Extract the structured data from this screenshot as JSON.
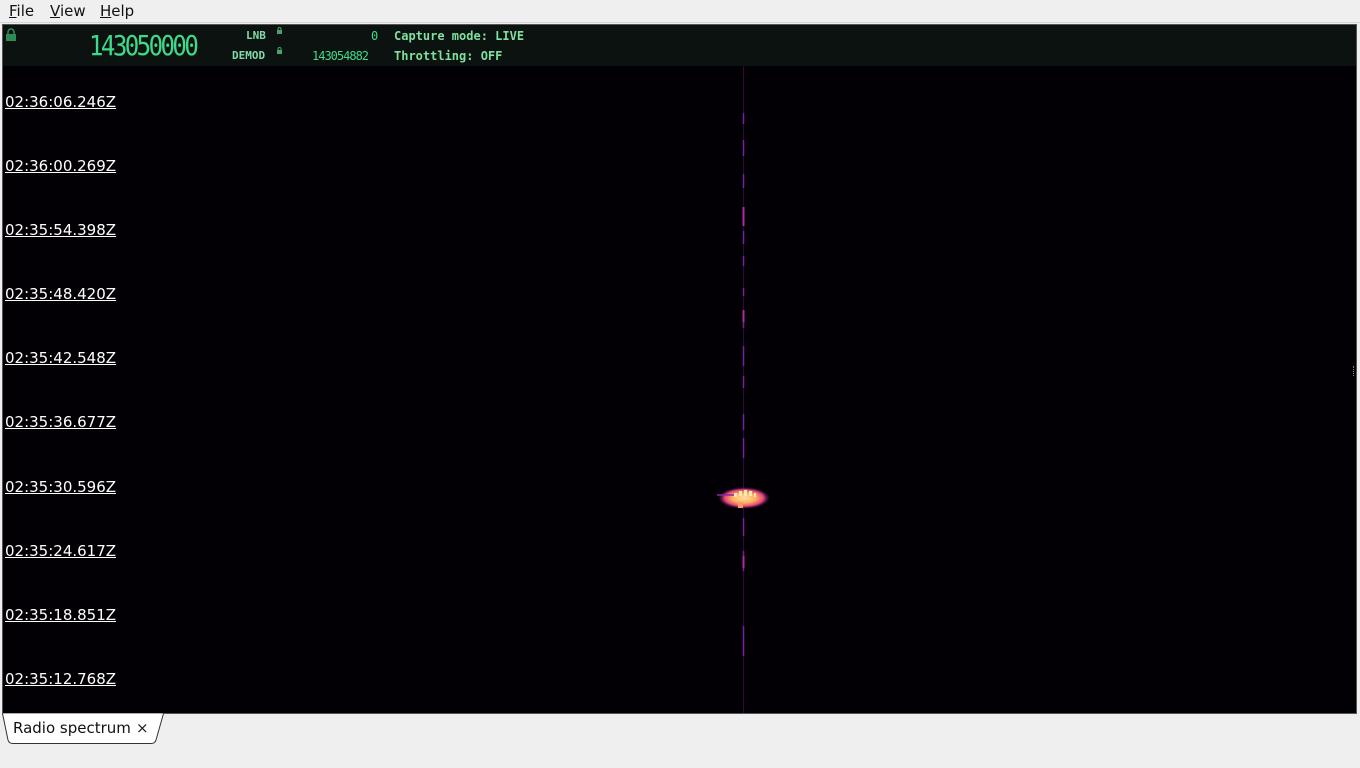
{
  "menubar": {
    "items": [
      {
        "label": "File",
        "accel": "F",
        "rest": "ile"
      },
      {
        "label": "View",
        "accel": "V",
        "rest": "iew"
      },
      {
        "label": "Help",
        "accel": "H",
        "rest": "elp"
      }
    ]
  },
  "header": {
    "main_frequency": "143050000",
    "lnb_label": "LNB",
    "lnb_value": "0",
    "demod_label": "DEMOD",
    "demod_value": "143054882",
    "capture_mode": "Capture mode: LIVE",
    "throttling": "Throttling: OFF",
    "icons": [
      "lock-icon",
      "small-lock-icon"
    ],
    "colors": {
      "digits": "#3fd98a",
      "text": "#7fe0a0",
      "background": "#0b1210"
    }
  },
  "waterfall": {
    "timestamps": [
      "02:36:06.246Z",
      "02:36:00.269Z",
      "02:35:54.398Z",
      "02:35:48.420Z",
      "02:35:42.548Z",
      "02:35:36.677Z",
      "02:35:30.596Z",
      "02:35:24.617Z",
      "02:35:18.851Z",
      "02:35:12.768Z"
    ],
    "colors": {
      "background": "#020005",
      "trace": "#7a1fa0",
      "burst_hot": "#ffd27a",
      "burst_warm": "#f05a7a"
    }
  },
  "tabs": [
    {
      "label": "Radio spectrum",
      "close": "×"
    }
  ]
}
